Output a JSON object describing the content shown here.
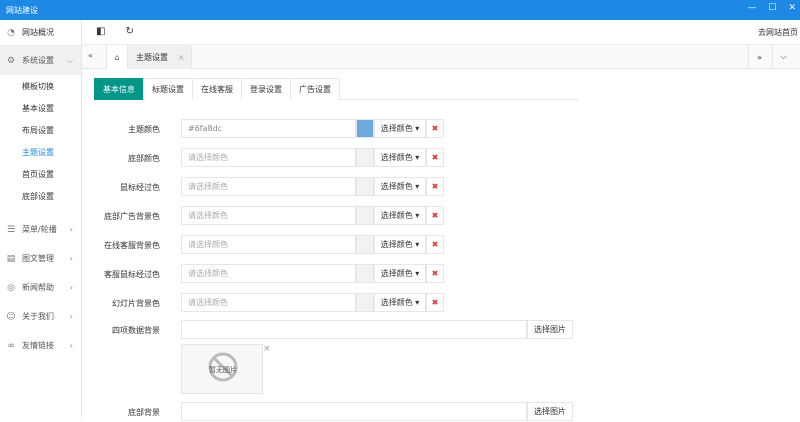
{
  "window": {
    "title": "网站建设",
    "minimize": "—",
    "maximize": "☐",
    "close": "✕"
  },
  "sidebar": {
    "top": {
      "label": "网站概况",
      "icon": "gauge-icon"
    },
    "group": {
      "label": "系统设置",
      "icon": "gear-icon"
    },
    "subitems": [
      "模板切换",
      "基本设置",
      "布局设置",
      "主题设置",
      "首页设置",
      "底部设置"
    ],
    "current_sub": "主题设置",
    "items": [
      {
        "label": "菜单/轮播",
        "icon": "list-icon"
      },
      {
        "label": "图文管理",
        "icon": "document-icon"
      },
      {
        "label": "新闻帮助",
        "icon": "help-icon"
      },
      {
        "label": "关于我们",
        "icon": "user-icon"
      },
      {
        "label": "友情链接",
        "icon": "link-icon"
      }
    ]
  },
  "toolbar": {
    "right_link": "去网站首页"
  },
  "tabbar": {
    "tab_label": "主题设置",
    "tab_close": "×",
    "collapse": "«",
    "next": "»",
    "more": "⌵"
  },
  "subtabs": [
    "基本信息",
    "标题设置",
    "在线客服",
    "登录设置",
    "广告设置"
  ],
  "form": {
    "pick_label": "选择颜色 ▾",
    "delete_label": "✖",
    "pick_image_label": "选择图片",
    "rows": [
      {
        "label": "主题颜色",
        "value": "#6fa8dc",
        "placeholder": "",
        "swatch": "#6fa8dc"
      },
      {
        "label": "底部颜色",
        "value": "",
        "placeholder": "请选择颜色",
        "swatch": ""
      },
      {
        "label": "鼠标经过色",
        "value": "",
        "placeholder": "请选择颜色",
        "swatch": ""
      },
      {
        "label": "底部广告背景色",
        "value": "",
        "placeholder": "请选择颜色",
        "swatch": ""
      },
      {
        "label": "在线客服背景色",
        "value": "",
        "placeholder": "请选择颜色",
        "swatch": ""
      },
      {
        "label": "客服鼠标经过色",
        "value": "",
        "placeholder": "请选择颜色",
        "swatch": ""
      },
      {
        "label": "幻灯片背景色",
        "value": "",
        "placeholder": "请选择颜色",
        "swatch": ""
      }
    ],
    "image_rows": [
      {
        "label": "四项数据背景"
      },
      {
        "label": "底部背景"
      }
    ],
    "no_image_text": "暂无图片",
    "no_image_close": "×"
  }
}
